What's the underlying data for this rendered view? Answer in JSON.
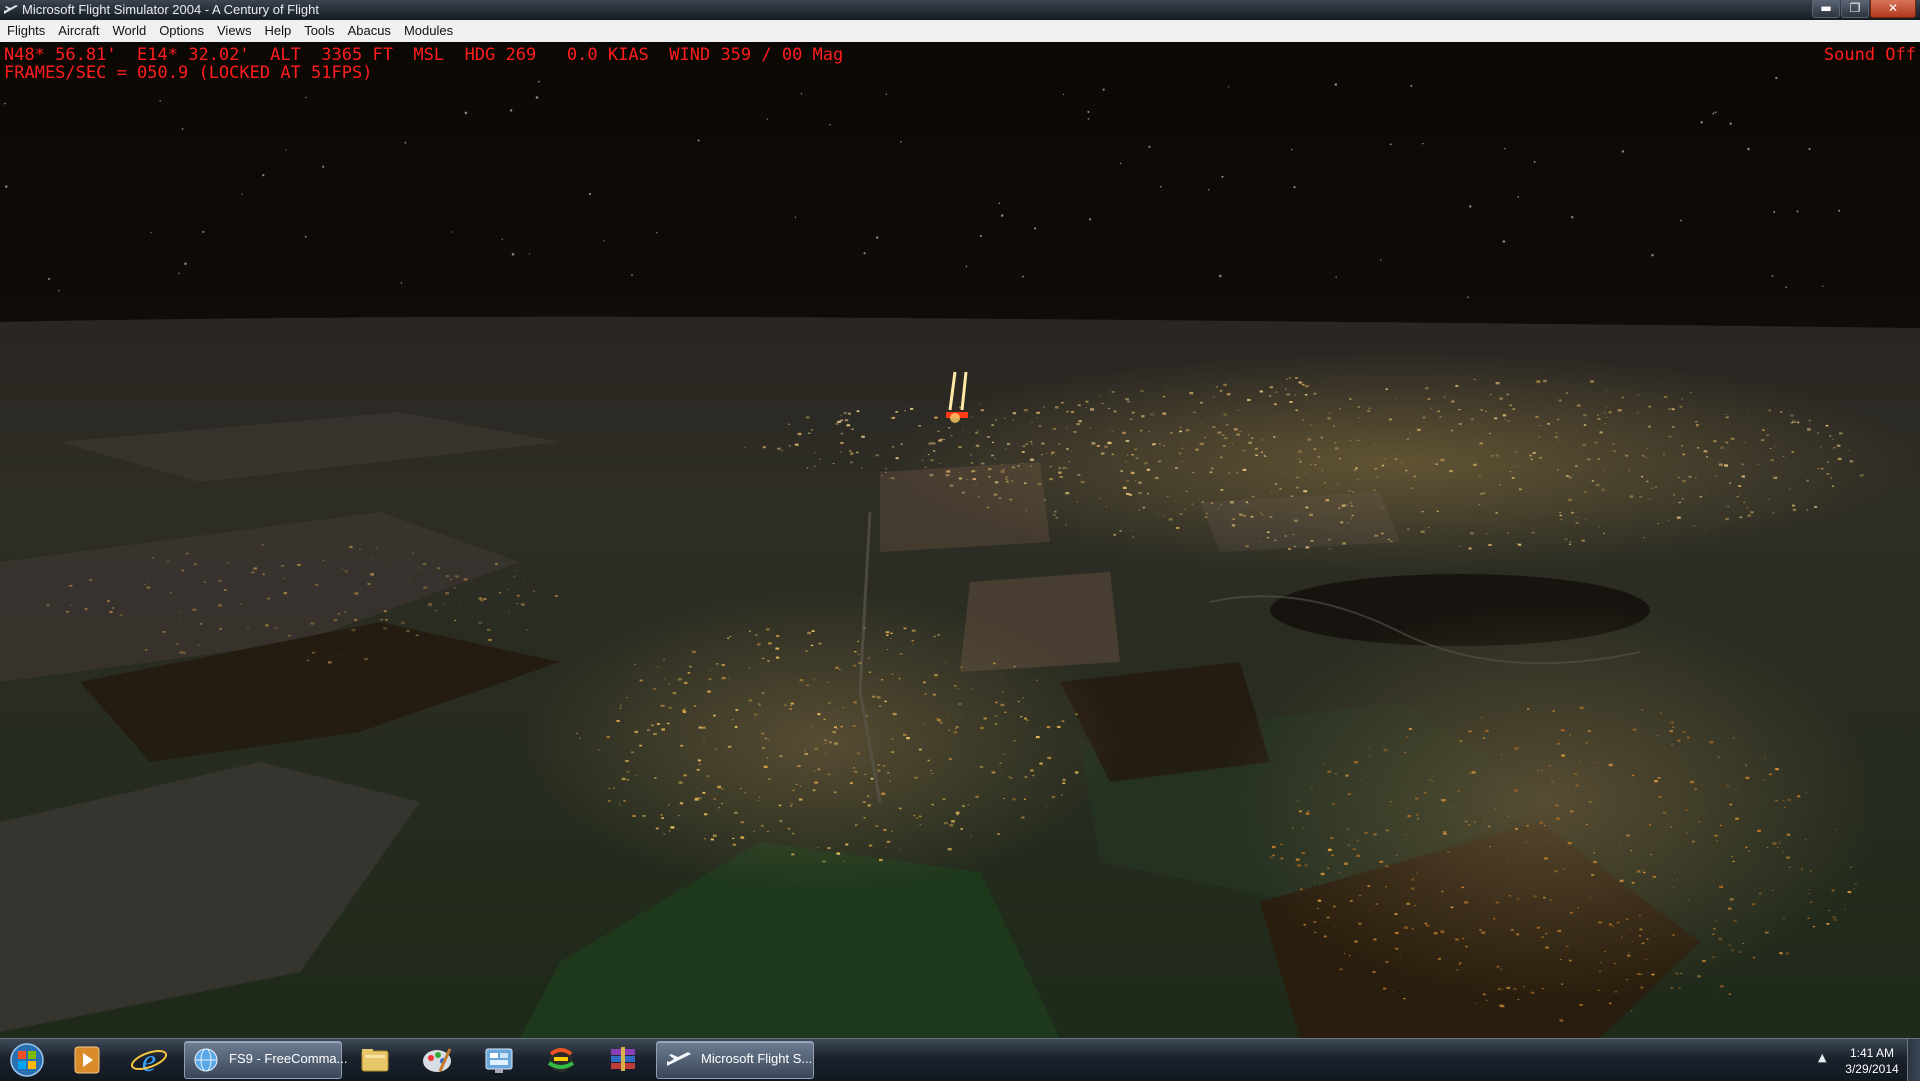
{
  "window": {
    "title": "Microsoft Flight Simulator 2004 - A Century of Flight",
    "controls": {
      "minimize": "▬",
      "maximize": "❐",
      "close": "✕"
    }
  },
  "menu": [
    "Flights",
    "Aircraft",
    "World",
    "Options",
    "Views",
    "Help",
    "Tools",
    "Abacus",
    "Modules"
  ],
  "hud": {
    "line1": "N48* 56.81'  E14* 32.02'  ALT  3365 FT  MSL  HDG 269   0.0 KIAS  WIND 359 / 00 Mag",
    "line2": "FRAMES/SEC = 050.9 (LOCKED AT 51FPS)",
    "sound": "Sound Off",
    "color": "#ff1d1d"
  },
  "taskbar": {
    "start_icon": "windows-orb-icon",
    "pinned": [
      "media-player-icon",
      "internet-explorer-icon"
    ],
    "tasks": [
      {
        "label": "FS9 - FreeComma...",
        "icon": "globe-app-icon"
      },
      {
        "label": "Microsoft Flight S...",
        "icon": "airplane-icon"
      }
    ],
    "pinned_after": [
      "file-explorer-icon",
      "paint-icon",
      "control-panel-icon",
      "color-app-icon",
      "winrar-icon"
    ],
    "clock": {
      "time": "1:41 AM",
      "date": "3/29/2014"
    }
  }
}
